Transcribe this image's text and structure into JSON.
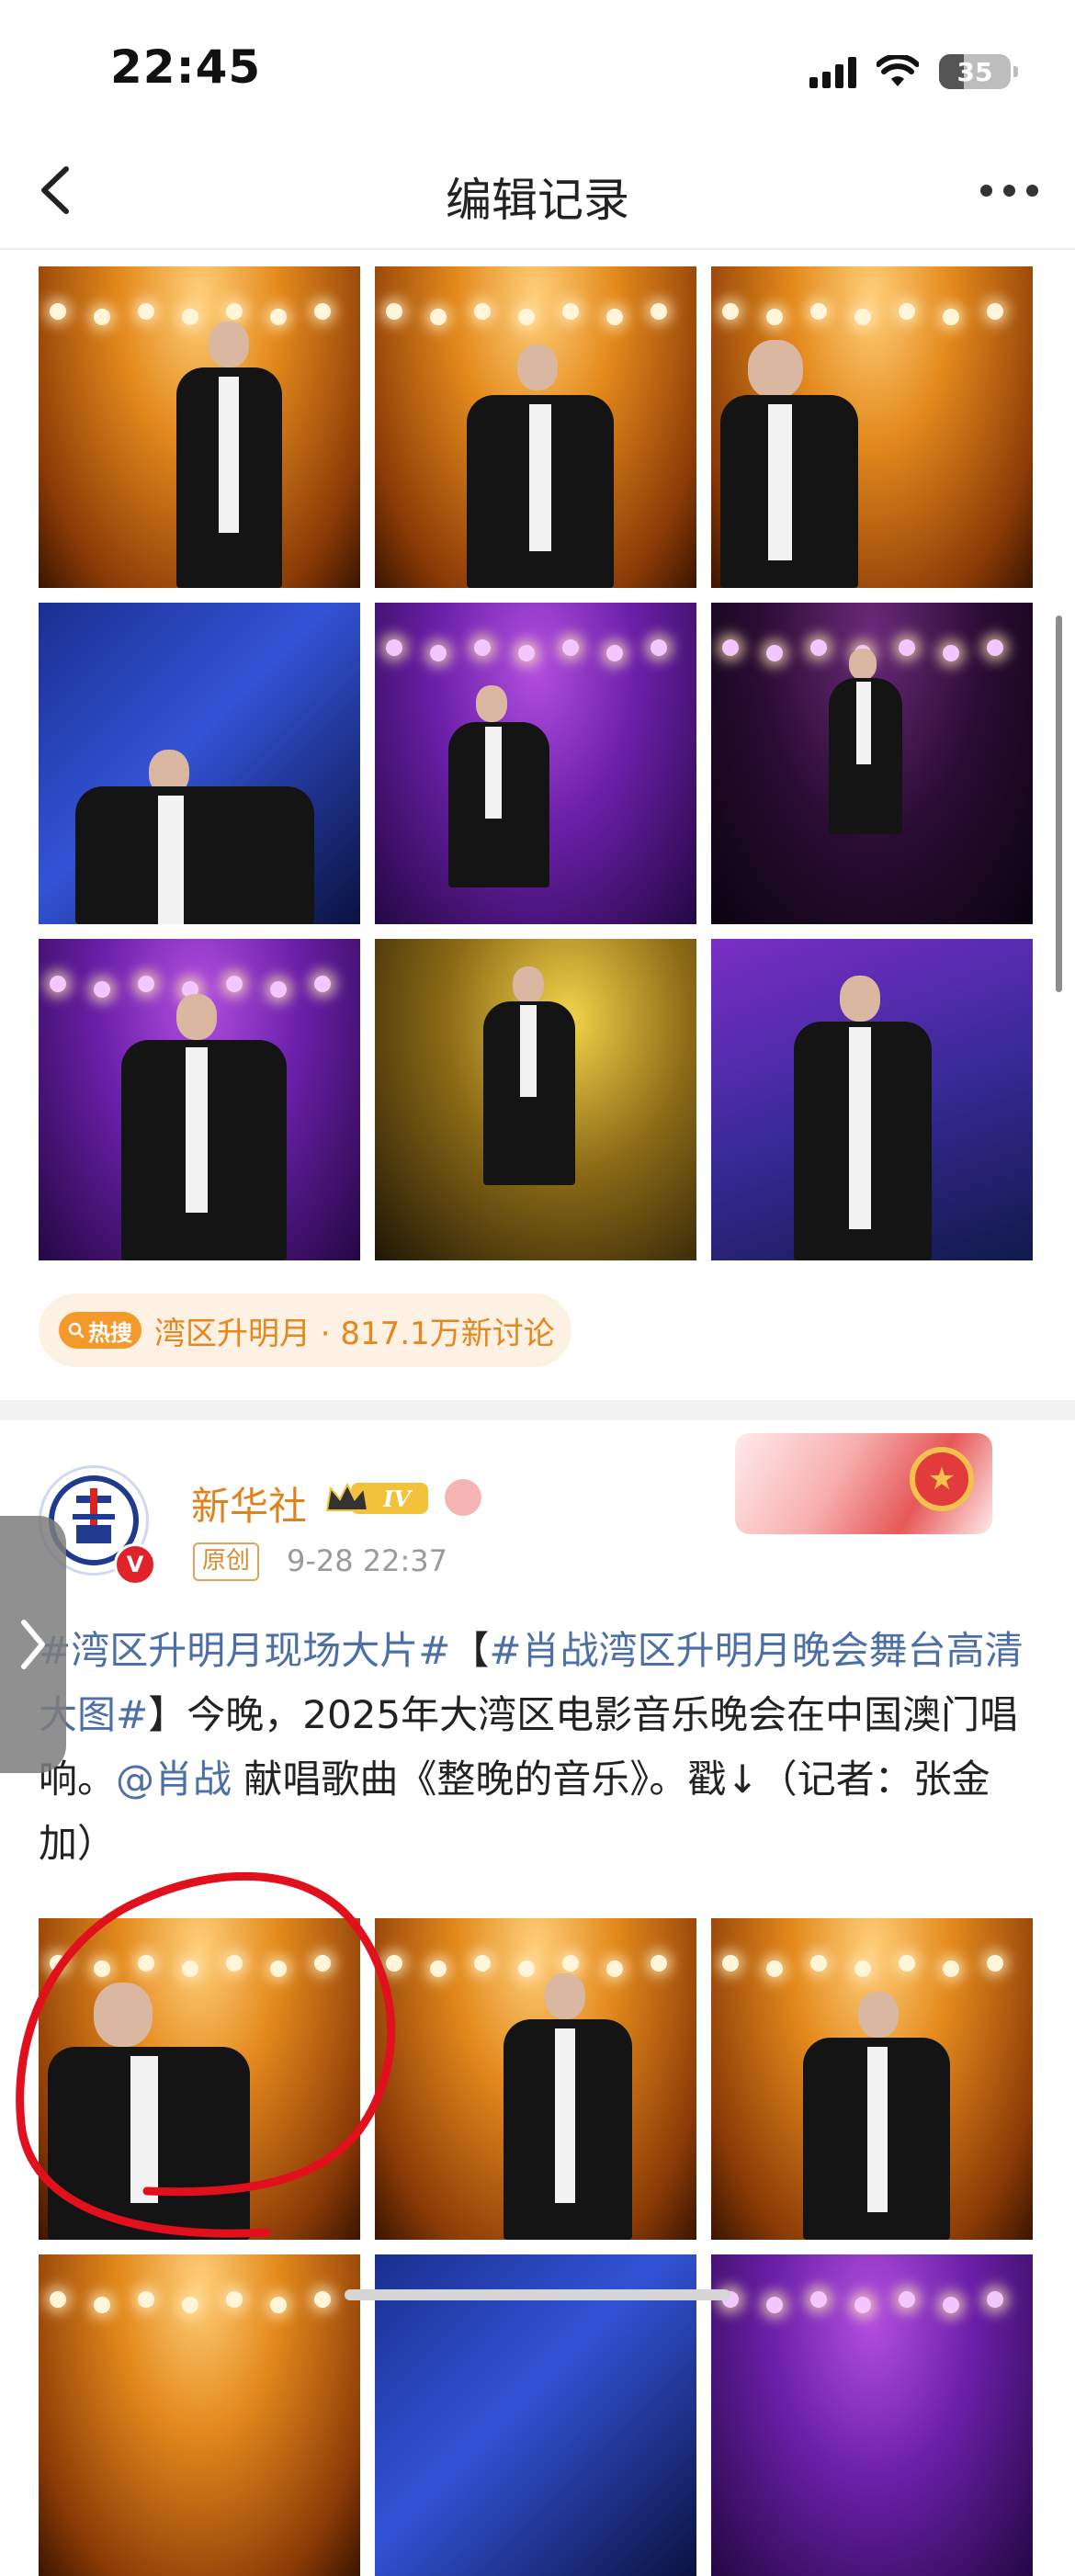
{
  "status_bar": {
    "time": "22:45",
    "battery": "35",
    "battery_level": 0.35
  },
  "nav": {
    "title": "编辑记录"
  },
  "hot_search": {
    "badge": "热搜",
    "text": "湾区升明月 · 817.1万新讨论"
  },
  "post": {
    "author": "新华社",
    "level": "IV",
    "original_tag": "原创",
    "time": "9-28 22:37",
    "avatar_verified": "V",
    "text": {
      "hashtag1": "#湾区升明月现场大片#",
      "bracket_open": "【",
      "hashtag2": "#肖战湾区升明月晚会舞台高清大图#",
      "bracket_close": "】",
      "body1": "今晚，2025年大湾区电影音乐晚会在中国澳门唱响。",
      "mention": "@肖战",
      "body2": " 献唱歌曲《整晚的音乐》。戳↓（记者：张金加）"
    }
  },
  "colors": {
    "accent_orange": "#e0821c",
    "link_blue": "#4d6fa8",
    "annotation_red": "#e0101c",
    "hot_bg": "#fdf1e4"
  },
  "icons": [
    "back-arrow-icon",
    "more-icon",
    "signal-icon",
    "wifi-icon",
    "battery-icon",
    "crown-icon",
    "chevron-right-icon"
  ]
}
